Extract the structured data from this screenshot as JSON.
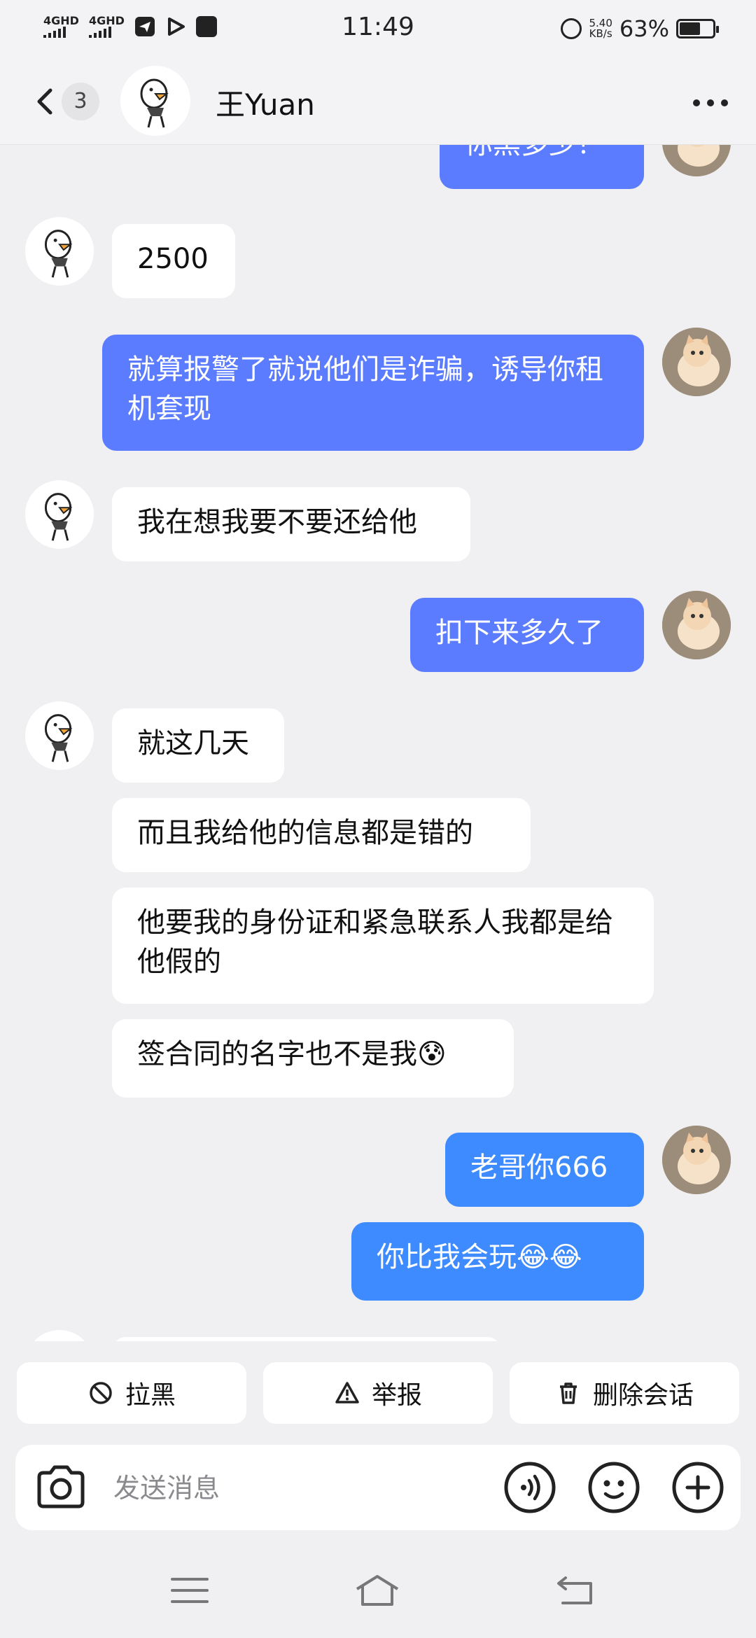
{
  "status": {
    "network1": "4GHD",
    "network2": "4GHD",
    "time": "11:49",
    "speed_value": "5.40",
    "speed_unit": "KB/s",
    "battery": "63%",
    "battery_level": 0.63
  },
  "header": {
    "unread_count": "3",
    "contact_name": "王Yuan"
  },
  "messages": [
    {
      "side": "out",
      "text": "你黑多少？"
    },
    {
      "side": "in",
      "text": "2500"
    },
    {
      "side": "out",
      "text": "就算报警了就说他们是诈骗，诱导你租机套现"
    },
    {
      "side": "in",
      "text": "我在想我要不要还给他"
    },
    {
      "side": "out",
      "text": "扣下来多久了"
    },
    {
      "side": "in",
      "text": "就这几天"
    },
    {
      "side": "in",
      "text": "而且我给他的信息都是错的"
    },
    {
      "side": "in",
      "text": "他要我的身份证和紧急联系人我都是给他假的"
    },
    {
      "side": "in",
      "text": "签合同的名字也不是我",
      "emoji": "😰"
    },
    {
      "side": "out",
      "text": "老哥你666"
    },
    {
      "side": "out",
      "text": "你比我会玩",
      "emoji": "😂😂"
    }
  ],
  "actions": {
    "block": "拉黑",
    "report": "举报",
    "delete": "删除会话"
  },
  "input": {
    "placeholder": "发送消息"
  },
  "icons": {
    "back": "chevron-left-icon",
    "more": "more-icon",
    "camera": "camera-icon",
    "voice": "voice-icon",
    "emoji": "emoji-icon",
    "plus": "plus-icon"
  },
  "colors": {
    "outgoing_bubble": "#5b7cff",
    "outgoing_bubble_alt": "#3d8bff",
    "incoming_bubble": "#ffffff",
    "background": "#f0f0f2"
  }
}
